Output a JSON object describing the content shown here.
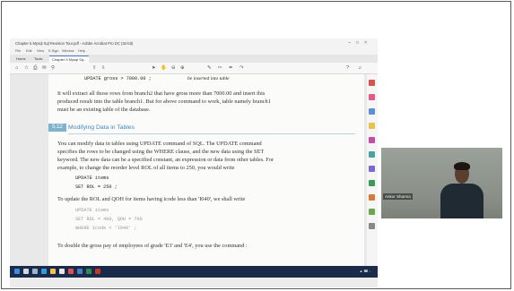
{
  "app": {
    "title": "Chapter 5 Mysql Sql Revision Tour.pdf - Adobe Acrobat Pro DC (32-bit)",
    "menu": [
      "File",
      "Edit",
      "View",
      "E-Sign",
      "Window",
      "Help"
    ],
    "tabs": [
      "Home",
      "Tools",
      "Chapter 5 Mysql Sq..."
    ],
    "active_tab_index": 2
  },
  "document": {
    "lines_top": [
      "UPDATE gross > 7000.00 ;",
      "It will extract all those rows from branch2 that have gross more than 7000.00 and insert this",
      "produced result into the table branch1. But for above command to work, table namely branch1",
      "must be an existing table of the database."
    ],
    "annotation": "be inserted into table",
    "section_number": "5.12",
    "section_title": "Modifying Data in Tables",
    "paragraph": [
      "You can modify data in tables using UPDATE command of SQL. The UPDATE command",
      "specifies the rows to be changed using the WHERE clause, and the new data using the SET",
      "keyword. The new data can be a specified constant, an expression or data from other tables. For",
      "example, to change the reorder level ROL of all items to 250, you would write"
    ],
    "code1": [
      "UPDATE items",
      "SET ROL = 250 ;"
    ],
    "para2": "To update the ROL and QOH for items having icode less than 'I040', we shall write",
    "code2": [
      "UPDATE items",
      "SET ROL = 400, QOH = 700",
      "WHERE icode < 'I040' ;"
    ],
    "para3": "To double the gross pay of employees of grade 'E3' and 'E4', you use the command :"
  },
  "participant": {
    "name": "Ankur Sharma"
  },
  "colors": {
    "section_bg": "#7fb2cc",
    "section_title": "#3f88b5",
    "taskbar": "#1c2a4a"
  }
}
